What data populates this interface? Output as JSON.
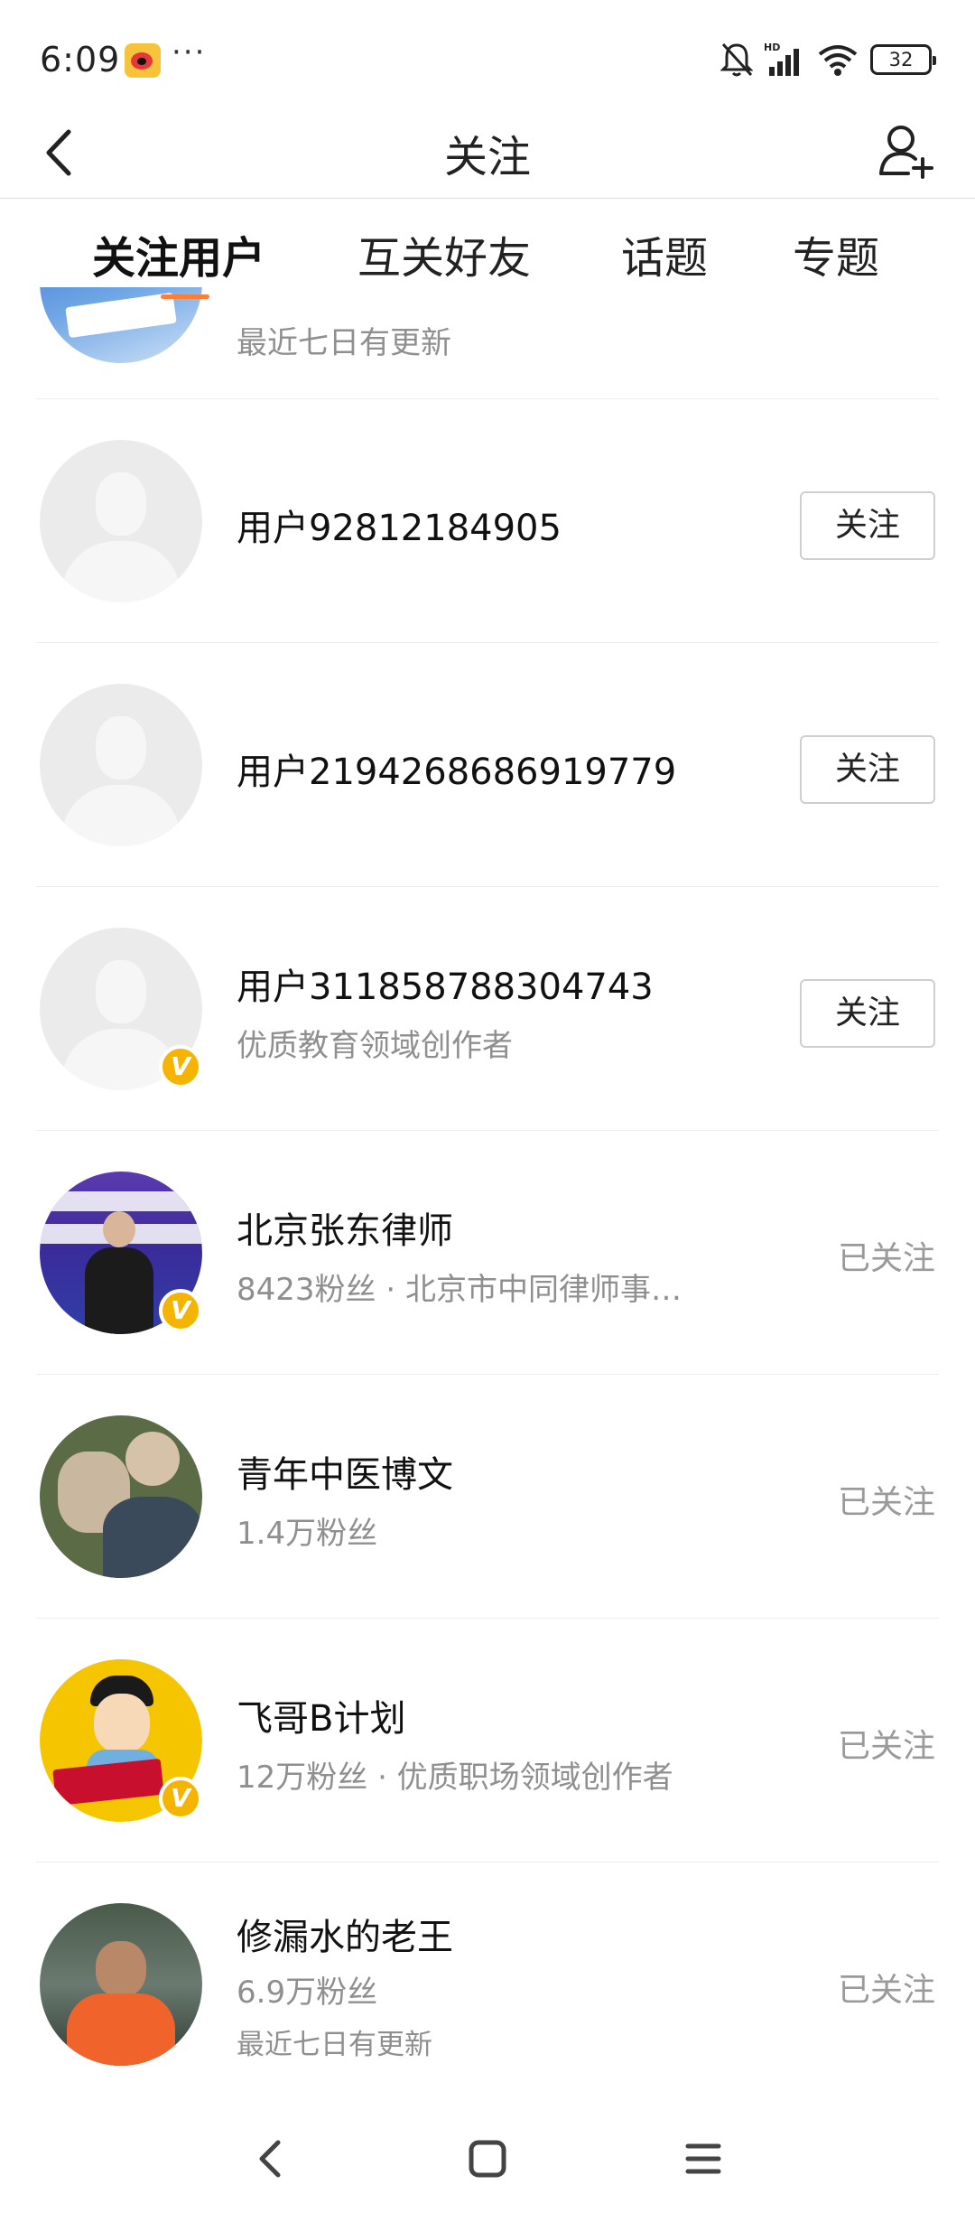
{
  "status_bar": {
    "time": "6:09",
    "app_icon": "weibo-icon",
    "dots": "···",
    "network": "HD",
    "battery": "32"
  },
  "header": {
    "title": "关注",
    "back_icon": "chevron-left-icon",
    "add_icon": "add-user-icon"
  },
  "tabs": [
    {
      "label": "关注用户",
      "active": true
    },
    {
      "label": "互关好友",
      "active": false
    },
    {
      "label": "话题",
      "active": false
    },
    {
      "label": "专题",
      "active": false
    }
  ],
  "users": [
    {
      "name": "",
      "subtitle": "最近七日有更新",
      "action": "",
      "avatar": "blue-logo-avatar"
    },
    {
      "name": "用户92812184905",
      "subtitle": "",
      "action": "关注",
      "avatar": "default-avatar"
    },
    {
      "name": "用户2194268686919779",
      "subtitle": "",
      "action": "关注",
      "avatar": "default-avatar"
    },
    {
      "name": "用户311858788304743",
      "subtitle": "优质教育领域创作者",
      "action": "关注",
      "avatar": "default-avatar",
      "verified": true
    },
    {
      "name": "北京张东律师",
      "subtitle": "8423粉丝 · 北京市中同律师事…",
      "action": "已关注",
      "avatar": "lawyer-avatar",
      "verified": true
    },
    {
      "name": "青年中医博文",
      "subtitle": "1.4万粉丝",
      "action": "已关注",
      "avatar": "photo-avatar"
    },
    {
      "name": "飞哥B计划",
      "subtitle": "12万粉丝 · 优质职场领域创作者",
      "action": "已关注",
      "avatar": "cartoon-avatar",
      "verified": true
    },
    {
      "name": "修漏水的老王",
      "subtitle": "6.9万粉丝",
      "subtitle2": "最近七日有更新",
      "action": "已关注",
      "avatar": "man-orange-shirt-avatar"
    }
  ],
  "badge_letter": "V",
  "nav": {
    "back": "back-triangle-icon",
    "home": "home-square-icon",
    "menu": "menu-lines-icon"
  },
  "colors": {
    "accent": "#ff7e36",
    "verified": "#f5b400",
    "secondary_text": "#8f8f8f"
  }
}
